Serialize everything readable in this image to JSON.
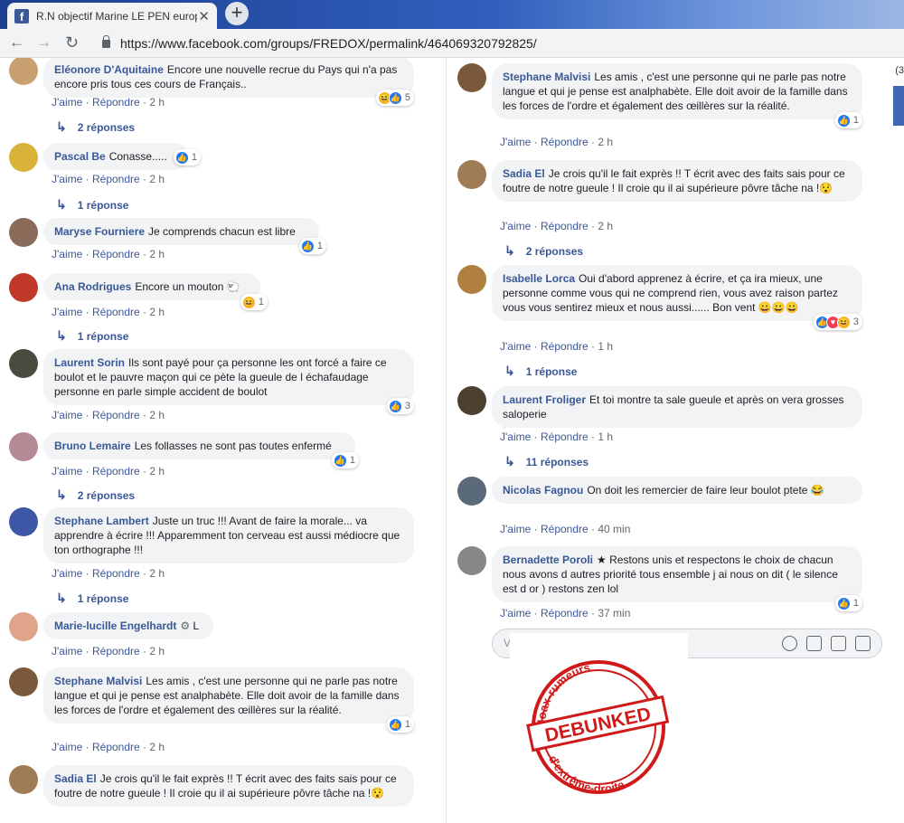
{
  "browser": {
    "tab_title": "R.N objectif Marine LE PEN europ",
    "tab_close": "✕",
    "new_tab": "+",
    "back": "←",
    "forward": "→",
    "reload": "↻",
    "url": "https://www.facebook.com/groups/FREDOX/permalink/464069320792825/"
  },
  "left_comments": [
    {
      "name": "Eléonore D'Aquitaine",
      "text": "Encore une nouvelle recrue du Pays qui n'a pas encore pris tous ces cours de Français..",
      "reactions": "5",
      "like": "J'aime",
      "reply": "Répondre",
      "time": "2 h",
      "replies": "2 réponses"
    },
    {
      "name": "Pascal Be",
      "text": "Conasse.....",
      "reactions": "1",
      "like": "J'aime",
      "reply": "Répondre",
      "time": "2 h",
      "replies": "1 réponse"
    },
    {
      "name": "Maryse Fourniere",
      "text": "Je comprends chacun est libre",
      "reactions": "1",
      "like": "J'aime",
      "reply": "Répondre",
      "time": "2 h"
    },
    {
      "name": "Ana Rodrigues",
      "text": "Encore un mouton",
      "reactions": "1",
      "like": "J'aime",
      "reply": "Répondre",
      "time": "2 h",
      "replies": "1 réponse"
    },
    {
      "name": "Laurent Sorin",
      "text": "Ils sont payé pour ça personne les ont forcé a faire ce boulot et le pauvre maçon qui ce pète la gueule de l échafaudage personne en parle simple accident de boulot",
      "reactions": "3",
      "like": "J'aime",
      "reply": "Répondre",
      "time": "2 h"
    },
    {
      "name": "Bruno Lemaire",
      "text": "Les follasses ne sont pas toutes enfermé",
      "reactions": "1",
      "like": "J'aime",
      "reply": "Répondre",
      "time": "2 h",
      "replies": "2 réponses"
    },
    {
      "name": "Stephane Lambert",
      "text": "Juste un truc !!! Avant de faire la morale... va apprendre à écrire !!! Apparemment ton cerveau est aussi médiocre que ton orthographe !!!",
      "like": "J'aime",
      "reply": "Répondre",
      "time": "2 h",
      "replies": "1 réponse"
    },
    {
      "name": "Marie-lucille Engelhardt",
      "text": "L",
      "like": "J'aime",
      "reply": "Répondre",
      "time": "2 h"
    },
    {
      "name": "Stephane Malvisi",
      "text": "Les amis , c'est une personne qui ne parle pas notre langue et qui je pense est analphabète. Elle doit avoir de la famille dans les forces de l'ordre et également des œillères sur la réalité.",
      "reactions": "1",
      "like": "J'aime",
      "reply": "Répondre",
      "time": "2 h"
    },
    {
      "name": "Sadia El",
      "text": "Je crois qu'il le fait exprès !! T écrit avec des faits sais pour ce foutre de notre gueule ! Il croie qu il ai supérieure pôvre tâche na !😯"
    }
  ],
  "right_comments": [
    {
      "name": "Stephane Malvisi",
      "text": "Les amis , c'est une personne qui ne parle pas notre langue et qui je pense est analphabète. Elle doit avoir de la famille dans les forces de l'ordre et également des œillères sur la réalité.",
      "reactions": "1",
      "like": "J'aime",
      "reply": "Répondre",
      "time": "2 h"
    },
    {
      "name": "Sadia El",
      "text": "Je crois qu'il le fait exprès !! T écrit avec des faits sais pour ce foutre de notre gueule ! Il croie qu il ai supérieure pôvre tâche na !😯",
      "like": "J'aime",
      "reply": "Répondre",
      "time": "2 h",
      "replies": "2 réponses"
    },
    {
      "name": "Isabelle Lorca",
      "text": "Oui d'abord apprenez à écrire, et ça ira mieux, une personne comme vous qui ne comprend rien, vous avez raison partez vous vous sentirez mieux et nous aussi...... Bon vent 😀😀😀",
      "reactions": "3",
      "like": "J'aime",
      "reply": "Répondre",
      "time": "1 h",
      "replies": "1 réponse"
    },
    {
      "name": "Laurent Froliger",
      "text": "Et toi montre ta sale gueule et après on vera grosses saloperie",
      "like": "J'aime",
      "reply": "Répondre",
      "time": "1 h",
      "replies": "11 réponses"
    },
    {
      "name": "Nicolas Fagnou",
      "text": "On doit les remercier de faire leur boulot ptete 😂",
      "like": "J'aime",
      "reply": "Répondre",
      "time": "40 min"
    },
    {
      "name": "Bernadette Poroli",
      "text": "★ Restons unis et respectons le choix de chacun nous avons d autres priorité tous ensemble j ai nous on dit ( le silence est d or ) restons zen lol",
      "reactions": "1",
      "like": "J'aime",
      "reply": "Répondre",
      "time": "37 min"
    }
  ],
  "write_box": {
    "placeholder": "V"
  },
  "side_counter": "(3",
  "stamp": {
    "top": "Hoax-rumeurs",
    "middle": "DEBUNKED",
    "bottom": "d'extrême-droite"
  },
  "colors": {
    "link": "#385898",
    "like": "#2078f4",
    "stamp": "#d01a1a"
  }
}
